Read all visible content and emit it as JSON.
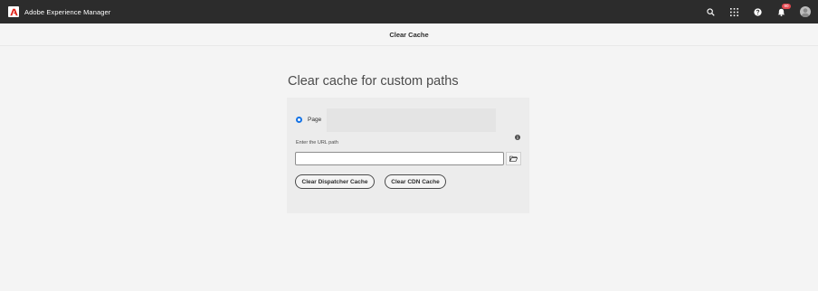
{
  "shell": {
    "brand": "Adobe Experience Manager",
    "notification_count": "90"
  },
  "titlebar": {
    "title": "Clear Cache"
  },
  "main": {
    "heading": "Clear cache for custom paths",
    "radio_label": "Page",
    "url_label": "Enter the URL path",
    "url_value": "",
    "clear_dispatcher_label": "Clear Dispatcher Cache",
    "clear_cdn_label": "Clear CDN Cache"
  },
  "colors": {
    "shell_bg": "#2c2c2c",
    "accent": "#1473e6",
    "badge": "#e34850",
    "page_bg": "#f4f4f4"
  },
  "icons": [
    "adobe-logo-icon",
    "search-icon",
    "apps-grid-icon",
    "help-icon",
    "bell-icon",
    "user-icon",
    "info-icon",
    "folder-icon"
  ]
}
